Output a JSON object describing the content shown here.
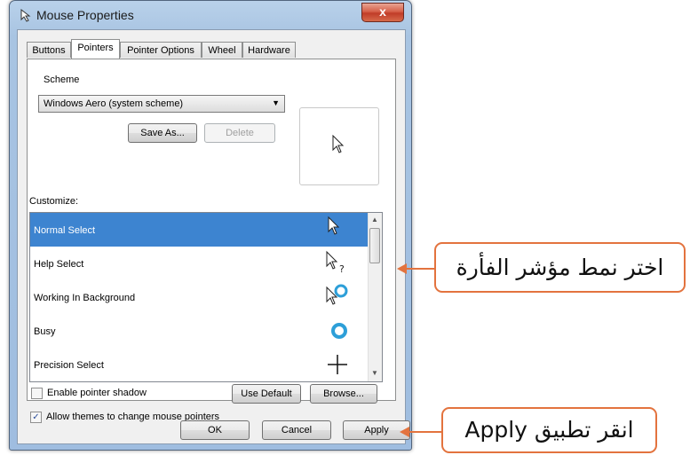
{
  "window": {
    "title": "Mouse Properties",
    "close_label": "x"
  },
  "tabs": [
    "Buttons",
    "Pointers",
    "Pointer Options",
    "Wheel",
    "Hardware"
  ],
  "active_tab": "Pointers",
  "scheme": {
    "label": "Scheme",
    "value": "Windows Aero (system scheme)",
    "save_as": "Save As...",
    "delete": "Delete"
  },
  "customize": {
    "label": "Customize:",
    "items": [
      {
        "label": "Normal Select",
        "icon": "arrow-cursor-icon",
        "selected": true
      },
      {
        "label": "Help Select",
        "icon": "help-cursor-icon",
        "selected": false
      },
      {
        "label": "Working In Background",
        "icon": "working-cursor-icon",
        "selected": false
      },
      {
        "label": "Busy",
        "icon": "busy-cursor-icon",
        "selected": false
      },
      {
        "label": "Precision Select",
        "icon": "crosshair-cursor-icon",
        "selected": false
      }
    ]
  },
  "options": {
    "shadow_label": "Enable pointer shadow",
    "shadow_checked": false,
    "themes_label": "Allow themes to change mouse pointers",
    "themes_checked": true,
    "use_default": "Use Default",
    "browse": "Browse..."
  },
  "footer": {
    "ok": "OK",
    "cancel": "Cancel",
    "apply": "Apply"
  },
  "callouts": {
    "pointer_style": "اختر نمط مؤشر الفأرة",
    "apply": "انقر تطبيق Apply"
  },
  "colors": {
    "accent": "#e3733e",
    "selection": "#3d84d0",
    "busy_ring": "#2d9fd8"
  }
}
